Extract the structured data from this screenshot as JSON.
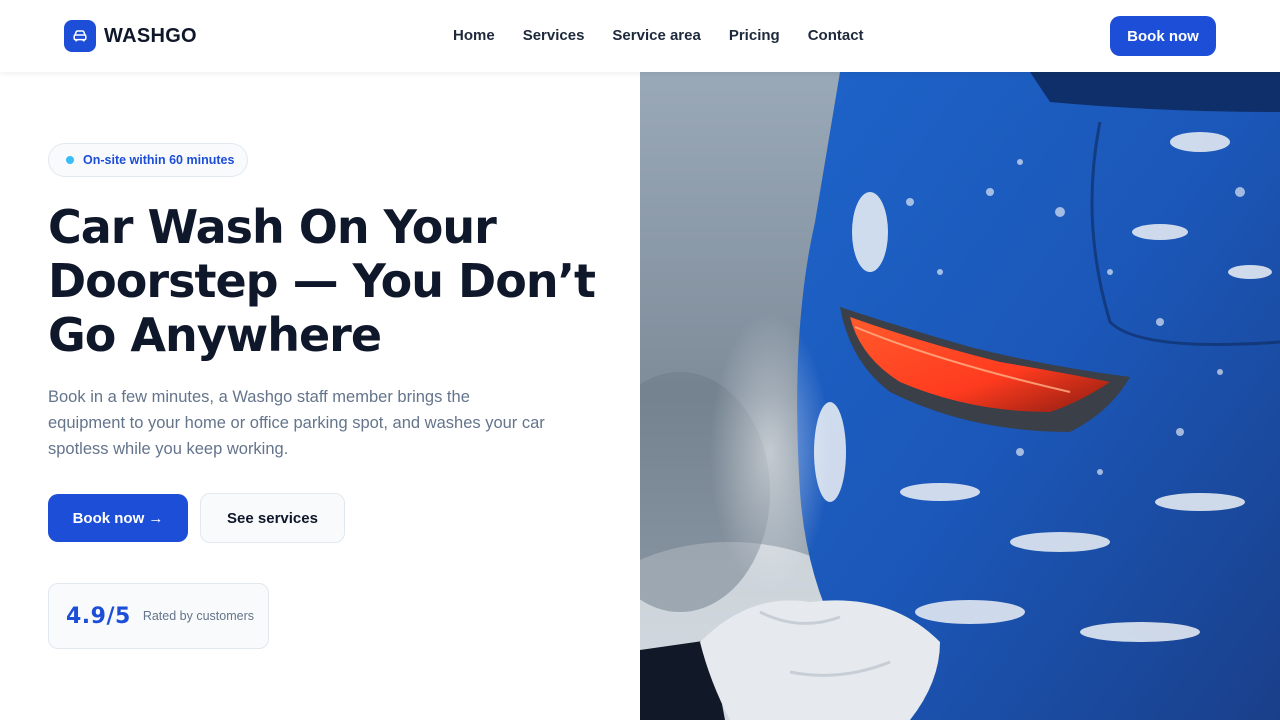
{
  "header": {
    "brand": "WASHGO",
    "logo_icon": "car-icon",
    "nav": [
      {
        "label": "Home"
      },
      {
        "label": "Services"
      },
      {
        "label": "Service area"
      },
      {
        "label": "Pricing"
      },
      {
        "label": "Contact"
      }
    ],
    "cta_label": "Book now"
  },
  "hero": {
    "badge": "On-site within 60 minutes",
    "headline_lines": [
      "Car Wash On Your",
      "Doorstep — You Don’t",
      "Go Anywhere"
    ],
    "subtext": "Book in a few minutes, a Washgo staff member brings the equipment to your home or office parking spot, and washes your car spotless while you keep working.",
    "primary_cta": "Book now →",
    "secondary_cta": "See services",
    "rating": {
      "value": "4.9/5",
      "label": "Rated by customers"
    },
    "image": "blue-car-covered-in-soap-being-washed"
  },
  "colors": {
    "accent": "#1d4ed8",
    "badge_dot": "#38bdf8",
    "text_dark": "#0f172a",
    "text_muted": "#64748b",
    "border": "#e2e8f0"
  }
}
